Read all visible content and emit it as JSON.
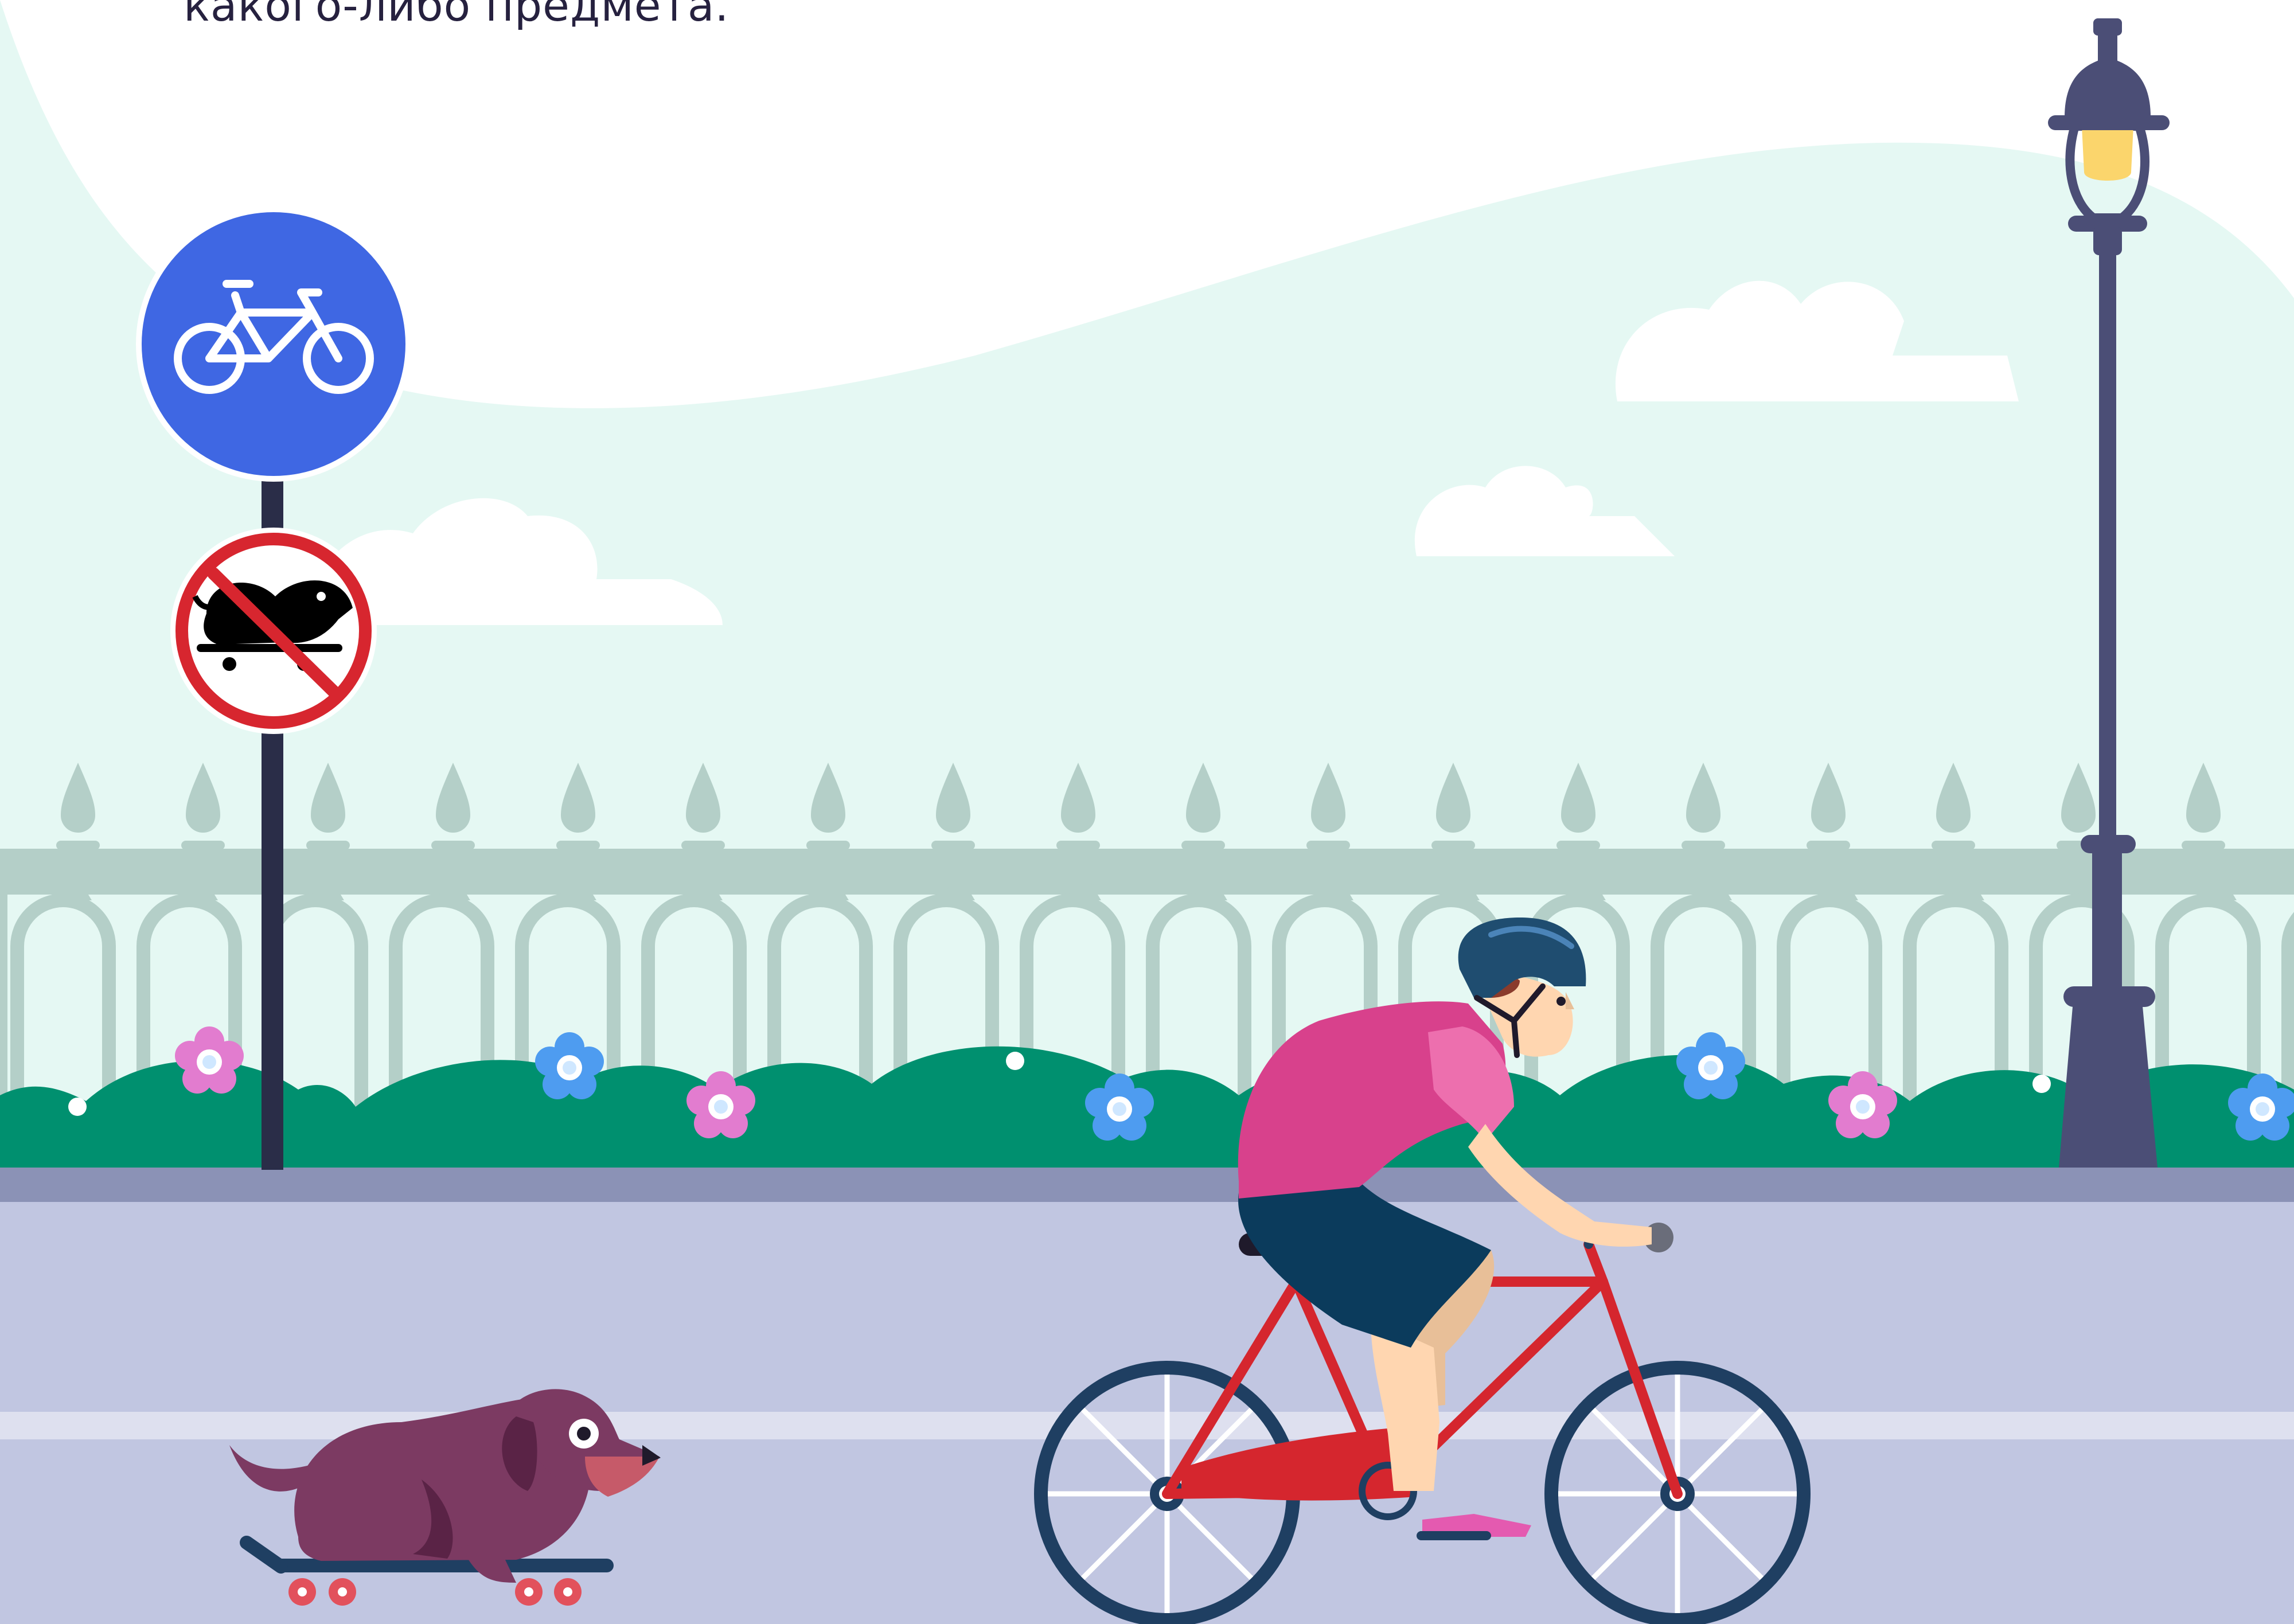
{
  "caption": "какого-либо предмета.",
  "signs": [
    {
      "icon": "bicycle-icon",
      "kind": "cycle-path",
      "color": "#3f67e3"
    },
    {
      "icon": "dog-on-skateboard-icon",
      "kind": "prohibition",
      "color": "#d7262f"
    }
  ],
  "colors": {
    "sky": "#e5f8f3",
    "fence": "#b4cfc8",
    "bushes": "#00906f",
    "road": "#c1c6e1",
    "lamp": "#4b4e76",
    "bike_frame": "#d5262e",
    "shirt": "#d8418c",
    "helmet": "#1f4d70",
    "dog": "#7c3a62"
  }
}
